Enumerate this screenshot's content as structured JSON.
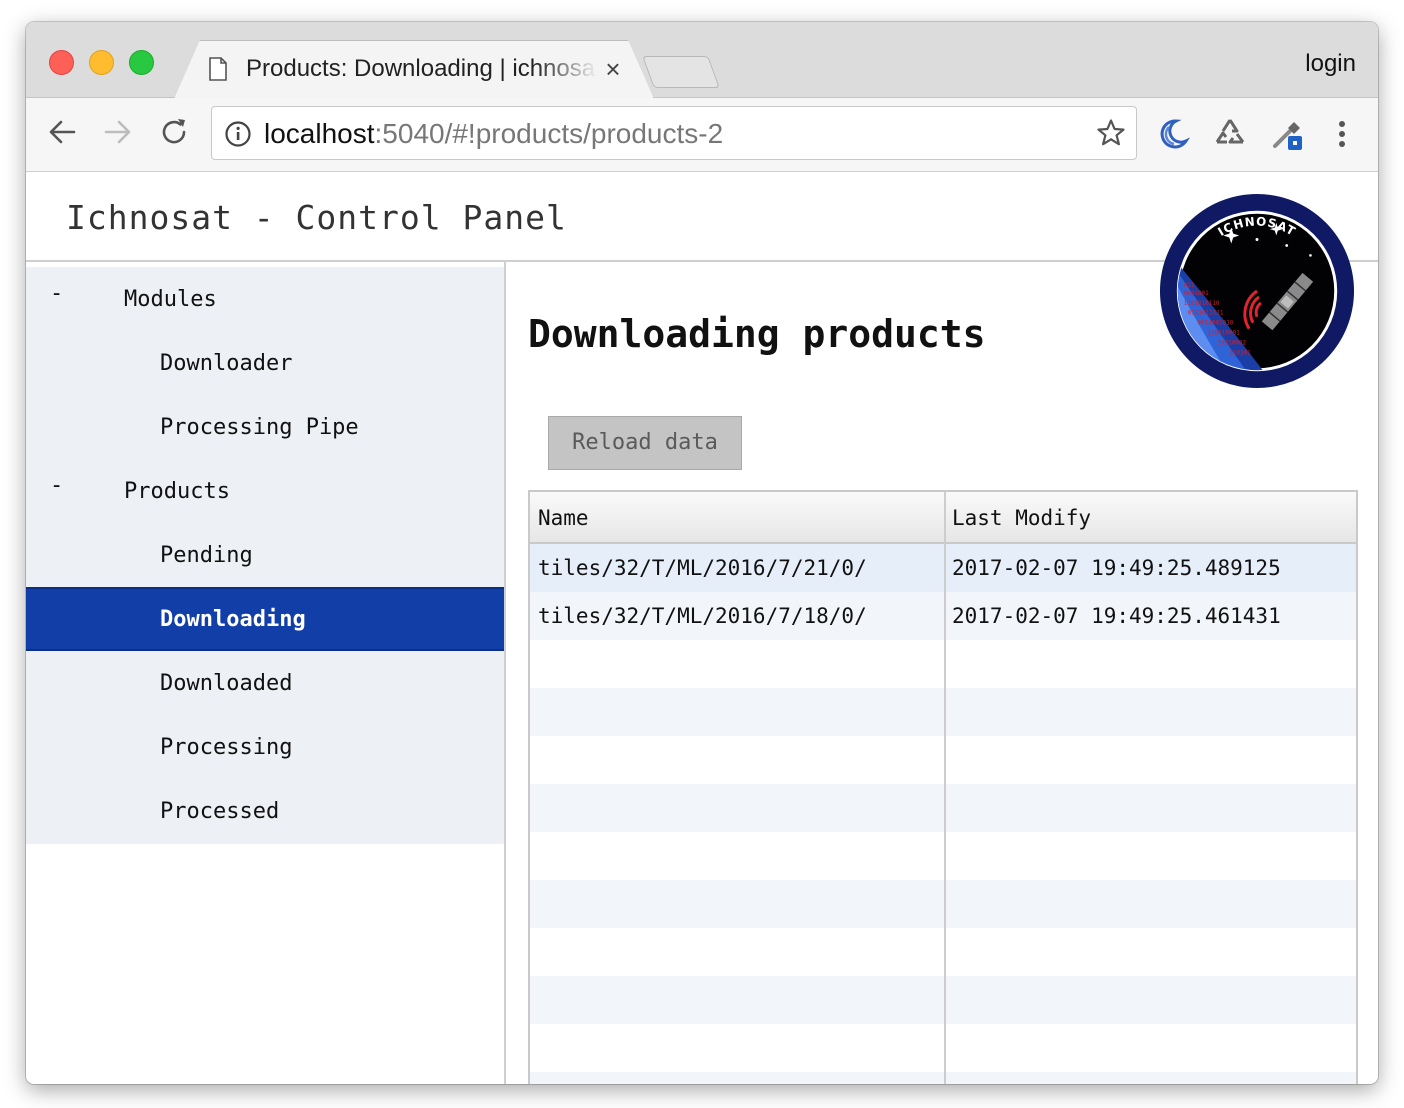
{
  "browser": {
    "tab_title": "Products: Downloading | ichnosat",
    "tab_close": "×",
    "login": "login",
    "url_host": "localhost",
    "url_rest": ":5040/#!products/products-2"
  },
  "app": {
    "title": "Ichnosat - Control Panel",
    "logo_text": "ICHNOSAT"
  },
  "sidebar": {
    "modules": {
      "toggle": "-",
      "label": "Modules",
      "items": [
        {
          "label": "Downloader"
        },
        {
          "label": "Processing Pipe"
        }
      ]
    },
    "products": {
      "toggle": "-",
      "label": "Products",
      "items": [
        {
          "label": "Pending"
        },
        {
          "label": "Downloading"
        },
        {
          "label": "Downloaded"
        },
        {
          "label": "Processing"
        },
        {
          "label": "Processed"
        }
      ]
    },
    "active": "Downloading"
  },
  "main": {
    "title": "Downloading products",
    "reload_label": "Reload data",
    "table": {
      "columns": [
        "Name",
        "Last Modify"
      ],
      "rows": [
        [
          "tiles/32/T/ML/2016/7/21/0/",
          "2017-02-07 19:49:25.489125"
        ],
        [
          "tiles/32/T/ML/2016/7/18/0/",
          "2017-02-07 19:49:25.461431"
        ]
      ]
    }
  },
  "colors": {
    "active_nav": "#123ea8",
    "sidebar_bg": "#edf0f4",
    "row_alt": "#f2f5fa",
    "row_selected": "#e6eefa"
  }
}
